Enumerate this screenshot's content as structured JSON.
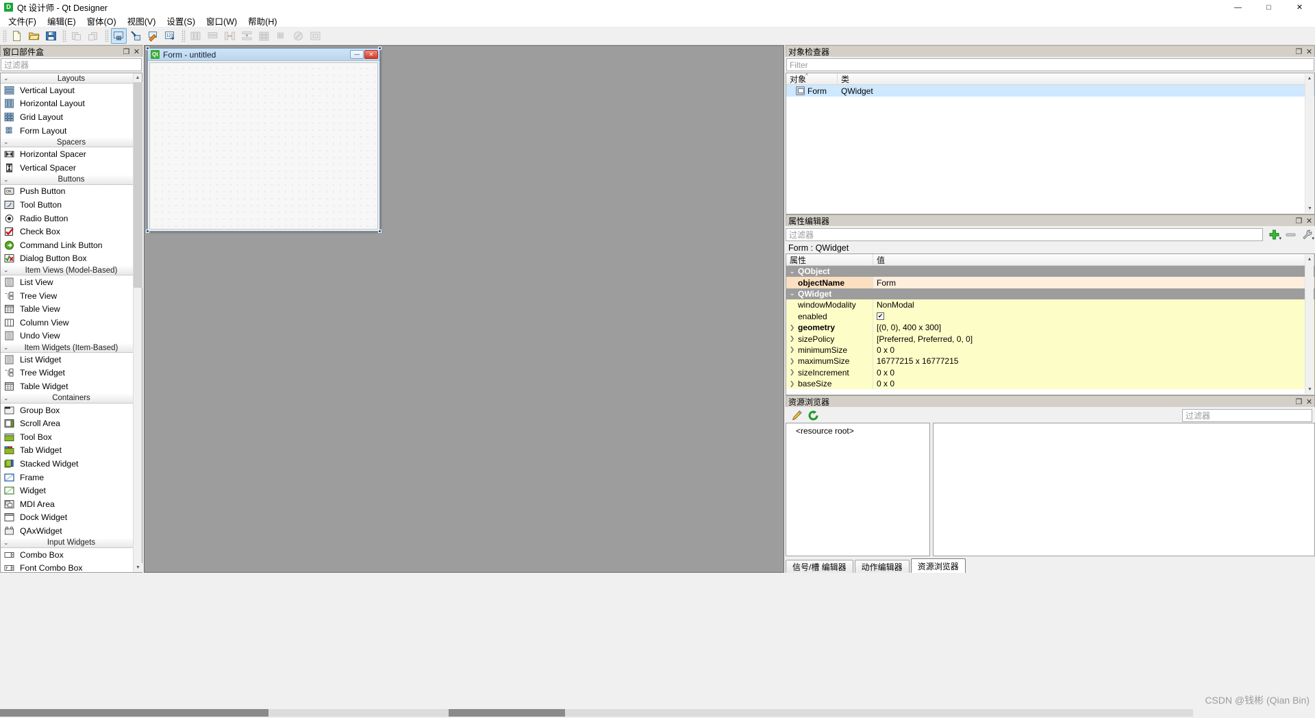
{
  "window": {
    "title": "Qt 设计师 - Qt Designer",
    "app_icon": "qt-designer-icon",
    "minimize_label": "—",
    "maximize_label": "□",
    "close_label": "✕"
  },
  "menubar": {
    "items": [
      {
        "label": "文件(F)",
        "name": "menu-file"
      },
      {
        "label": "编辑(E)",
        "name": "menu-edit"
      },
      {
        "label": "窗体(O)",
        "name": "menu-form"
      },
      {
        "label": "视图(V)",
        "name": "menu-view"
      },
      {
        "label": "设置(S)",
        "name": "menu-settings"
      },
      {
        "label": "窗口(W)",
        "name": "menu-window"
      },
      {
        "label": "帮助(H)",
        "name": "menu-help"
      }
    ]
  },
  "toolbar": {
    "groups": [
      {
        "buttons": [
          {
            "icon": "new-file-icon",
            "title": "新建",
            "state": "enabled"
          },
          {
            "icon": "open-folder-icon",
            "title": "打开",
            "state": "enabled"
          },
          {
            "icon": "save-icon",
            "title": "保存",
            "state": "enabled"
          }
        ]
      },
      {
        "buttons": [
          {
            "icon": "undo-icon",
            "title": "撤销",
            "state": "disabled"
          },
          {
            "icon": "redo-icon",
            "title": "重做",
            "state": "disabled"
          }
        ]
      },
      {
        "buttons": [
          {
            "icon": "edit-widgets-icon",
            "title": "编辑窗口部件",
            "state": "active"
          },
          {
            "icon": "edit-signals-slots-icon",
            "title": "编辑信号/槽",
            "state": "enabled"
          },
          {
            "icon": "edit-buddies-icon",
            "title": "编辑伙伴",
            "state": "enabled"
          },
          {
            "icon": "edit-tab-order-icon",
            "title": "编辑 Tab 顺序",
            "state": "enabled"
          }
        ]
      },
      {
        "buttons": [
          {
            "icon": "layout-horizontal-icon",
            "title": "水平布局",
            "state": "disabled"
          },
          {
            "icon": "layout-vertical-icon",
            "title": "垂直布局",
            "state": "disabled"
          },
          {
            "icon": "layout-splitter-h-icon",
            "title": "水平分裂器布局",
            "state": "disabled"
          },
          {
            "icon": "layout-splitter-v-icon",
            "title": "垂直分裂器布局",
            "state": "disabled"
          },
          {
            "icon": "layout-grid-icon",
            "title": "栅格布局",
            "state": "disabled"
          },
          {
            "icon": "layout-form-icon",
            "title": "表单布局",
            "state": "disabled"
          },
          {
            "icon": "break-layout-icon",
            "title": "打破布局",
            "state": "disabled"
          },
          {
            "icon": "adjust-size-icon",
            "title": "调整大小",
            "state": "disabled"
          }
        ]
      }
    ]
  },
  "widget_box": {
    "title": "窗口部件盒",
    "float_label": "❐",
    "close_label": "✕",
    "filter_placeholder": "过滤器",
    "chevron": "⌄",
    "sections": [
      {
        "name": "Layouts",
        "items": [
          {
            "label": "Vertical Layout",
            "icon": "vertical-layout-icon"
          },
          {
            "label": "Horizontal Layout",
            "icon": "horizontal-layout-icon"
          },
          {
            "label": "Grid Layout",
            "icon": "grid-layout-icon"
          },
          {
            "label": "Form Layout",
            "icon": "form-layout-icon"
          }
        ]
      },
      {
        "name": "Spacers",
        "items": [
          {
            "label": "Horizontal Spacer",
            "icon": "horizontal-spacer-icon"
          },
          {
            "label": "Vertical Spacer",
            "icon": "vertical-spacer-icon"
          }
        ]
      },
      {
        "name": "Buttons",
        "items": [
          {
            "label": "Push Button",
            "icon": "push-button-icon"
          },
          {
            "label": "Tool Button",
            "icon": "tool-button-icon"
          },
          {
            "label": "Radio Button",
            "icon": "radio-button-icon"
          },
          {
            "label": "Check Box",
            "icon": "check-box-icon"
          },
          {
            "label": "Command Link Button",
            "icon": "command-link-button-icon"
          },
          {
            "label": "Dialog Button Box",
            "icon": "dialog-button-box-icon"
          }
        ]
      },
      {
        "name": "Item Views (Model-Based)",
        "items": [
          {
            "label": "List View",
            "icon": "list-view-icon"
          },
          {
            "label": "Tree View",
            "icon": "tree-view-icon"
          },
          {
            "label": "Table View",
            "icon": "table-view-icon"
          },
          {
            "label": "Column View",
            "icon": "column-view-icon"
          },
          {
            "label": "Undo View",
            "icon": "undo-view-icon"
          }
        ]
      },
      {
        "name": "Item Widgets (Item-Based)",
        "items": [
          {
            "label": "List Widget",
            "icon": "list-widget-icon"
          },
          {
            "label": "Tree Widget",
            "icon": "tree-widget-icon"
          },
          {
            "label": "Table Widget",
            "icon": "table-widget-icon"
          }
        ]
      },
      {
        "name": "Containers",
        "items": [
          {
            "label": "Group Box",
            "icon": "group-box-icon"
          },
          {
            "label": "Scroll Area",
            "icon": "scroll-area-icon"
          },
          {
            "label": "Tool Box",
            "icon": "tool-box-icon"
          },
          {
            "label": "Tab Widget",
            "icon": "tab-widget-icon"
          },
          {
            "label": "Stacked Widget",
            "icon": "stacked-widget-icon"
          },
          {
            "label": "Frame",
            "icon": "frame-icon"
          },
          {
            "label": "Widget",
            "icon": "widget-icon"
          },
          {
            "label": "MDI Area",
            "icon": "mdi-area-icon"
          },
          {
            "label": "Dock Widget",
            "icon": "dock-widget-icon"
          },
          {
            "label": "QAxWidget",
            "icon": "qaxwidget-icon"
          }
        ]
      },
      {
        "name": "Input Widgets",
        "items": [
          {
            "label": "Combo Box",
            "icon": "combo-box-icon"
          },
          {
            "label": "Font Combo Box",
            "icon": "font-combo-box-icon"
          }
        ]
      }
    ]
  },
  "form_window": {
    "title": "Form - untitled",
    "icon": "qt-logo-icon",
    "minimize_label": "—",
    "maximize_label": "□",
    "close_label": "✕"
  },
  "object_inspector": {
    "title": "对象检查器",
    "float_label": "❐",
    "close_label": "✕",
    "filter_placeholder": "Filter",
    "columns": [
      "对象",
      "类"
    ],
    "sort_arrow": "^",
    "rows": [
      {
        "object": "Form",
        "class": "QWidget",
        "icon": "widget-node-icon"
      }
    ]
  },
  "property_editor": {
    "title": "属性编辑器",
    "float_label": "❐",
    "close_label": "✕",
    "filter_placeholder": "过滤器",
    "add_icon": "plus-icon",
    "remove_icon": "minus-icon",
    "configure_icon": "wrench-icon",
    "object_line": "Form : QWidget",
    "columns": [
      "属性",
      "值"
    ],
    "rows": [
      {
        "kind": "group",
        "name": "QObject",
        "value": ""
      },
      {
        "kind": "hl",
        "name": "objectName",
        "value": "Form",
        "bold": true
      },
      {
        "kind": "group",
        "name": "QWidget",
        "value": ""
      },
      {
        "kind": "yel",
        "name": "windowModality",
        "value": "NonModal"
      },
      {
        "kind": "yel",
        "name": "enabled",
        "value": "",
        "checkbox": true,
        "checked": true
      },
      {
        "kind": "yel",
        "name": "geometry",
        "value": "[(0, 0), 400 x 300]",
        "expandable": true,
        "bold": true
      },
      {
        "kind": "yel",
        "name": "sizePolicy",
        "value": "[Preferred, Preferred, 0, 0]",
        "expandable": true
      },
      {
        "kind": "yel",
        "name": "minimumSize",
        "value": "0 x 0",
        "expandable": true
      },
      {
        "kind": "yel",
        "name": "maximumSize",
        "value": "16777215 x 16777215",
        "expandable": true
      },
      {
        "kind": "yel",
        "name": "sizeIncrement",
        "value": "0 x 0",
        "expandable": true
      },
      {
        "kind": "yel",
        "name": "baseSize",
        "value": "0 x 0",
        "expandable": true
      }
    ]
  },
  "resource_browser": {
    "title": "资源浏览器",
    "float_label": "❐",
    "close_label": "✕",
    "edit_icon": "pencil-icon",
    "reload_icon": "reload-icon",
    "filter_placeholder": "过滤器",
    "root_label": "<resource root>",
    "tabs": [
      {
        "label": "信号/槽 编辑器",
        "active": false
      },
      {
        "label": "动作编辑器",
        "active": false
      },
      {
        "label": "资源浏览器",
        "active": true
      }
    ]
  },
  "watermark": "CSDN @钱彬 (Qian Bin)",
  "colors": {
    "accent": "#2c5f9e",
    "dock_title": "#d4d0c8",
    "workspace": "#9d9d9d",
    "property_highlight": "#fdeedd",
    "property_yellow": "#fdfdc8",
    "group_row": "#9d9d9d",
    "selection": "#cde8ff"
  }
}
